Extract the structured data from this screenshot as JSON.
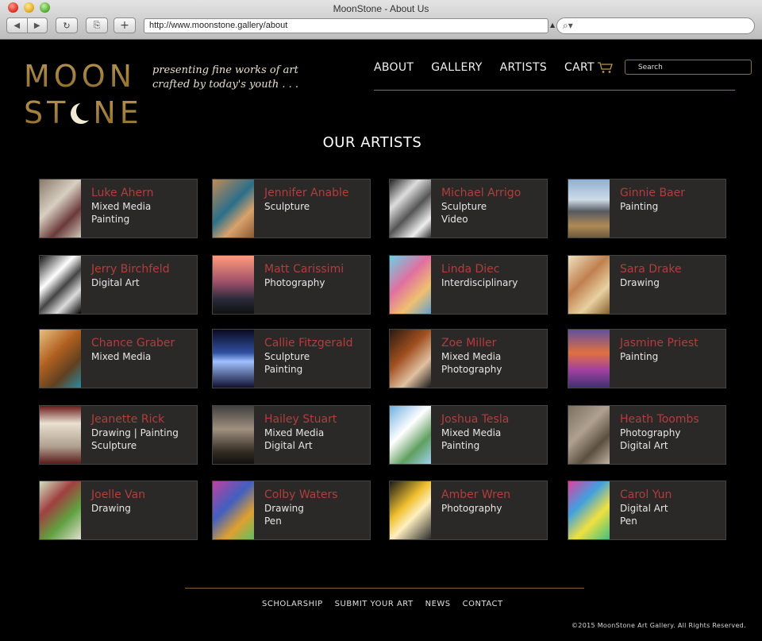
{
  "browser": {
    "window_title": "MoonStone - About Us",
    "url": "http://www.moonstone.gallery/about"
  },
  "site": {
    "logo_line1": "MOON",
    "logo_line2_a": "ST",
    "logo_line2_b": "NE",
    "tagline1": "presenting fine works of art",
    "tagline2": "crafted by today's youth  . . .",
    "nav": {
      "about": "ABOUT",
      "gallery": "GALLERY",
      "artists": "ARTISTS",
      "cart": "CART"
    },
    "search_placeholder": "Search",
    "colors": {
      "gold": "#8e7233",
      "name_red": "#b43c3c",
      "card_bg": "#2b2928"
    }
  },
  "section_title": "OUR ARTISTS",
  "artists": [
    {
      "name": "Luke Ahern",
      "media": [
        "Mixed Media",
        "Painting"
      ]
    },
    {
      "name": "Jennifer Anable",
      "media": [
        "Sculpture"
      ]
    },
    {
      "name": "Michael Arrigo",
      "media": [
        "Sculpture",
        "Video"
      ]
    },
    {
      "name": "Ginnie Baer",
      "media": [
        "Painting"
      ]
    },
    {
      "name": "Jerry Birchfeld",
      "media": [
        "Digital Art"
      ]
    },
    {
      "name": "Matt Carissimi",
      "media": [
        "Photography"
      ]
    },
    {
      "name": "Linda Diec",
      "media": [
        "Interdisciplinary"
      ]
    },
    {
      "name": "Sara Drake",
      "media": [
        "Drawing"
      ]
    },
    {
      "name": "Chance Graber",
      "media": [
        "Mixed Media"
      ]
    },
    {
      "name": "Callie Fitzgerald",
      "media": [
        "Sculpture",
        "Painting"
      ]
    },
    {
      "name": "Zoe Miller",
      "media": [
        "Mixed Media",
        "Photography"
      ]
    },
    {
      "name": "Jasmine Priest",
      "media": [
        "Painting"
      ]
    },
    {
      "name": "Jeanette Rick",
      "media": [
        "Drawing | Painting",
        "Sculpture"
      ]
    },
    {
      "name": "Hailey Stuart",
      "media": [
        "Mixed Media",
        "Digital Art"
      ]
    },
    {
      "name": "Joshua Tesla",
      "media": [
        "Mixed Media",
        "Painting"
      ]
    },
    {
      "name": "Heath Toombs",
      "media": [
        "Photography",
        "Digital Art"
      ]
    },
    {
      "name": "Joelle Van",
      "media": [
        "Drawing"
      ]
    },
    {
      "name": "Colby Waters",
      "media": [
        "Drawing",
        "Pen"
      ]
    },
    {
      "name": "Amber Wren",
      "media": [
        "Photography"
      ]
    },
    {
      "name": "Carol Yun",
      "media": [
        "Digital Art",
        "Pen"
      ]
    }
  ],
  "footer": {
    "links": [
      "SCHOLARSHIP",
      "SUBMIT YOUR ART",
      "NEWS",
      "CONTACT"
    ],
    "copyright": "©2015 MoonStone Art Gallery. All Rights Reserved."
  }
}
